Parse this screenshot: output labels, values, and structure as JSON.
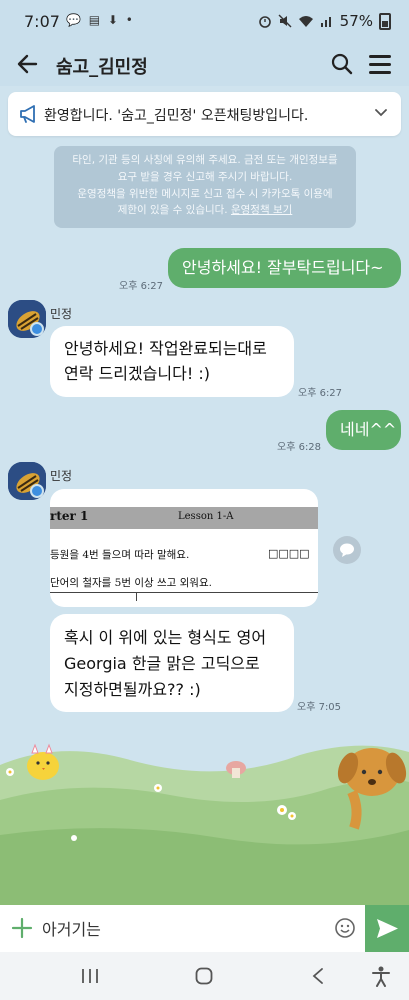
{
  "status": {
    "time": "7:07",
    "left_icons": "💬 ▤ ⬇ •",
    "battery": "57%"
  },
  "header": {
    "title": "숨고_김민정"
  },
  "notice": {
    "text": "환영합니다. '숨고_김민정' 오픈채팅방입니다."
  },
  "system_message": {
    "line1": "타인, 기관 등의 사칭에 유의해 주세요. 금전 또는 개인정보를",
    "line2": "요구 받을 경우 신고해 주시기 바랍니다.",
    "line3": "운영정책을 위반한 메시지로 신고 접수 시 카카오톡 이용에",
    "line4": "제한이 있을 수 있습니다.",
    "link": "운영정책 보기"
  },
  "messages": [
    {
      "text": "안녕하세요! 잘부탁드립니다~",
      "time": "오후 6:27"
    },
    {
      "sender": "민정",
      "line1": "안녕하세요! 작업완료되는대로",
      "line2": "연락 드리겠습니다! :)",
      "time": "오후 6:27"
    },
    {
      "text": "네네^^",
      "time": "오후 6:28"
    },
    {
      "sender": "민정"
    },
    {
      "line1": "혹시 이 위에 있는 형식도 영어",
      "line2": "Georgia 한글 맑은 고딕으로",
      "line3": "지정하면될까요?? :)",
      "time": "오후 7:05"
    }
  ],
  "image_card": {
    "title_left": "rter 1",
    "title_right": "Lesson 1-A",
    "line1": "등원을 4번 들으며 따라 말해요.",
    "boxes": "□□□□",
    "line2": "단어의 철자를 5번 이상 쓰고 외워요."
  },
  "input": {
    "placeholder": "아거기는"
  },
  "colors": {
    "chat_background": "#cfe3ee",
    "outgoing_bubble": "#5fae6c",
    "incoming_bubble": "#ffffff",
    "send_button": "#5fae6c"
  }
}
